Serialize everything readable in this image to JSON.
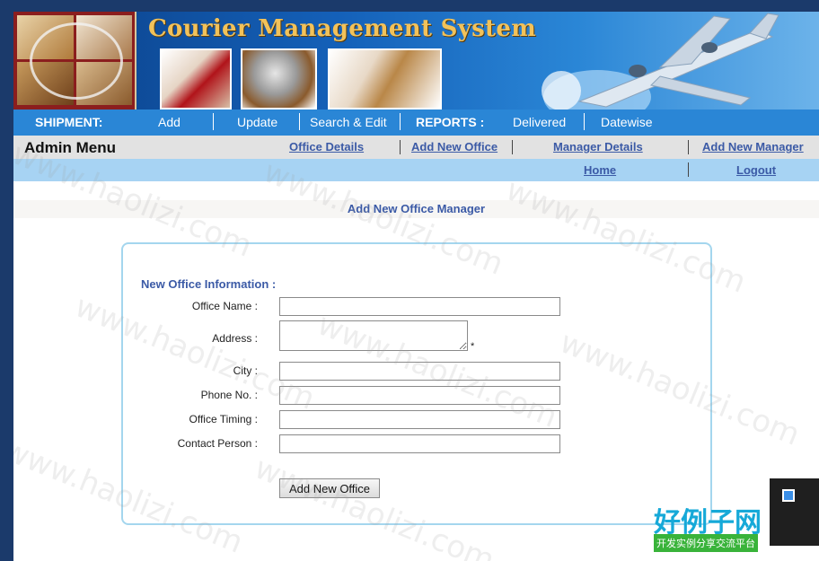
{
  "header": {
    "title": "Courier Management System"
  },
  "nav": {
    "shipment_label": "SHIPMENT:",
    "add": "Add",
    "update": "Update",
    "search_edit": "Search & Edit",
    "reports_label": "REPORTS :",
    "delivered": "Delivered",
    "datewise": "Datewise"
  },
  "admin_menu": {
    "title": "Admin Menu",
    "office_details": "Office Details",
    "add_new_office": "Add New Office",
    "manager_details": "Manager Details",
    "add_new_manager": "Add New Manager",
    "home": "Home",
    "logout": "Logout"
  },
  "page": {
    "heading": "Add New Office Manager"
  },
  "form": {
    "section_title": "New Office Information :",
    "office_name_label": "Office Name :",
    "address_label": "Address :",
    "address_required": "*",
    "city_label": "City :",
    "phone_label": "Phone No. :",
    "timing_label": "Office Timing :",
    "contact_label": "Contact Person :",
    "office_name_value": "",
    "address_value": "",
    "city_value": "",
    "phone_value": "",
    "timing_value": "",
    "contact_value": "",
    "submit_label": "Add New Office"
  },
  "watermark": {
    "text": "www.haolizi.com",
    "badge_main": "好例子网",
    "badge_sub": "开发实例分享交流平台"
  }
}
